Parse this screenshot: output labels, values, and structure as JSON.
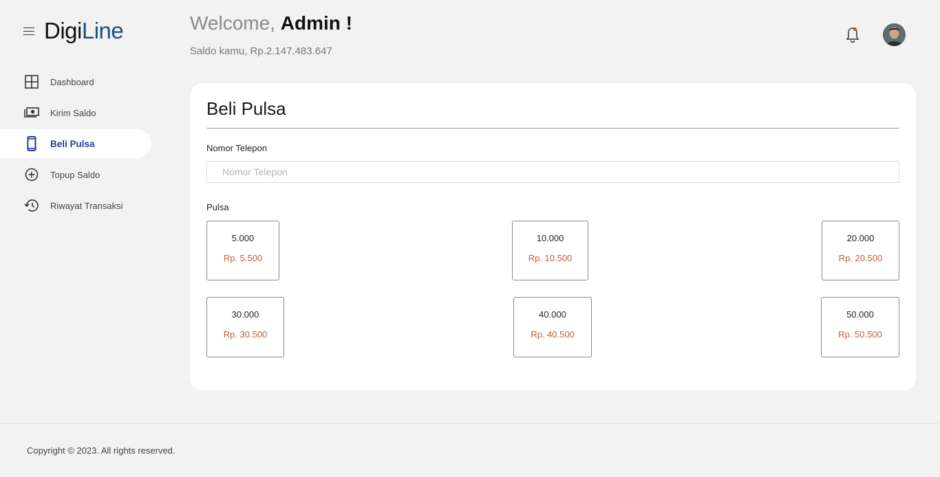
{
  "brand": {
    "part1": "Digi",
    "part2": "Line"
  },
  "sidebar": {
    "items": [
      {
        "label": "Dashboard",
        "icon": "grid-icon"
      },
      {
        "label": "Kirim Saldo",
        "icon": "money-icon"
      },
      {
        "label": "Beli Pulsa",
        "icon": "smartphone-icon",
        "active": true
      },
      {
        "label": "Topup Saldo",
        "icon": "plus-circle-icon"
      },
      {
        "label": "Riwayat Transaksi",
        "icon": "history-icon"
      }
    ]
  },
  "header": {
    "welcome_prefix": "Welcome,",
    "welcome_name": "Admin !",
    "saldo": "Saldo kamu, Rp.2.147.483.647"
  },
  "card": {
    "title": "Beli Pulsa",
    "phone_label": "Nomor Telepon",
    "phone_placeholder": "Nomor Telepon",
    "phone_value": "",
    "pulsa_label": "Pulsa",
    "options": [
      {
        "amount": "5.000",
        "price": "Rp. 5.500"
      },
      {
        "amount": "10.000",
        "price": "Rp. 10.500"
      },
      {
        "amount": "20.000",
        "price": "Rp. 20.500"
      },
      {
        "amount": "30.000",
        "price": "Rp. 30.500"
      },
      {
        "amount": "40.000",
        "price": "Rp. 40.500"
      },
      {
        "amount": "50.000",
        "price": "Rp. 50.500"
      }
    ]
  },
  "footer": {
    "copyright": "Copyright © 2023. All rights reserved."
  },
  "colors": {
    "accent": "#2a3a96",
    "logo_blue": "#1e4f7f",
    "price": "#c0603a",
    "background": "#f2f2f3"
  }
}
